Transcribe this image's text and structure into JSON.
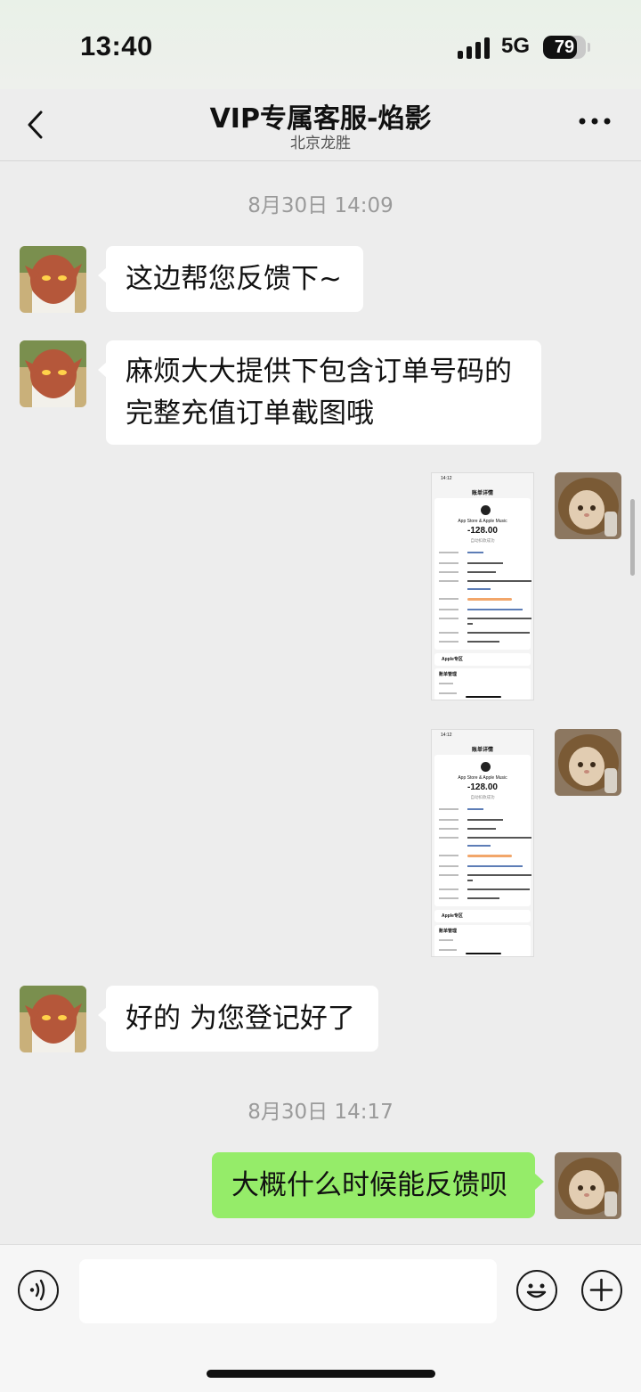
{
  "status_bar": {
    "time": "13:40",
    "network": "5G",
    "battery": "79",
    "battery_level": 0.79
  },
  "header": {
    "title": "VIP专属客服-焰影",
    "subtitle": "北京龙胜"
  },
  "messages": {
    "ts1": "8月30日 14:09",
    "m1": "这边帮您反馈下~",
    "m2_line1": "麻烦大大提供下包含订单号码的",
    "m2_line2": "完整充值订单截图哦",
    "m5": "好的 为您登记好了",
    "ts2": "8月30日 14:17",
    "m6": "大概什么时候能反馈呗"
  },
  "receipts": [
    {
      "status_time": "14:12",
      "title": "账单详情",
      "merchant": "App Store & Apple Music",
      "amount": "-128.00",
      "status": "自动扣款成功",
      "section1": "Apple专区",
      "section2": "账单管理"
    },
    {
      "status_time": "14:12",
      "title": "账单详情",
      "merchant": "App Store & Apple Music",
      "amount": "-128.00",
      "status": "自动扣款成功",
      "section1": "Apple专区",
      "section2": "账单管理"
    }
  ],
  "colors": {
    "own_bubble": "#95ec69",
    "other_bubble": "#ffffff",
    "background": "#ededed"
  },
  "icons": {
    "voice": "voice-icon",
    "emoji": "emoji-icon",
    "plus": "plus-icon",
    "back": "back-chevron-icon",
    "more": "more-icon"
  }
}
